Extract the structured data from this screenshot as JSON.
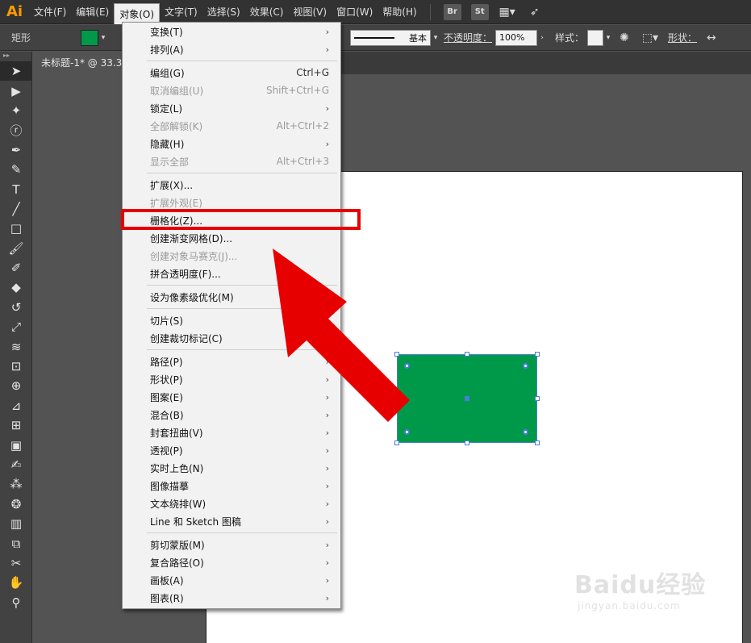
{
  "app": {
    "logo": "Ai"
  },
  "menubar": {
    "items": [
      "文件(F)",
      "编辑(E)",
      "对象(O)",
      "文字(T)",
      "选择(S)",
      "效果(C)",
      "视图(V)",
      "窗口(W)",
      "帮助(H)"
    ],
    "active_index": 2,
    "bridge_label": "Br",
    "stock_label": "St"
  },
  "controlbar": {
    "shape_label": "矩形",
    "fill_color": "#00994a",
    "stroke_label": "基本",
    "opacity_label": "不透明度：",
    "opacity_value": "100%",
    "style_label": "样式：",
    "shape_props_label": "形状："
  },
  "document": {
    "tab_title": "未标题-1* @ 33.3"
  },
  "object_menu": {
    "items": [
      {
        "label": "变换(T)",
        "shortcut": "",
        "submenu": true,
        "disabled": false
      },
      {
        "label": "排列(A)",
        "shortcut": "",
        "submenu": true,
        "disabled": false
      },
      {
        "label": "编组(G)",
        "shortcut": "Ctrl+G",
        "submenu": false,
        "disabled": false
      },
      {
        "label": "取消编组(U)",
        "shortcut": "Shift+Ctrl+G",
        "submenu": false,
        "disabled": true
      },
      {
        "label": "锁定(L)",
        "shortcut": "",
        "submenu": true,
        "disabled": false
      },
      {
        "label": "全部解锁(K)",
        "shortcut": "Alt+Ctrl+2",
        "submenu": false,
        "disabled": true
      },
      {
        "label": "隐藏(H)",
        "shortcut": "",
        "submenu": true,
        "disabled": false
      },
      {
        "label": "显示全部",
        "shortcut": "Alt+Ctrl+3",
        "submenu": false,
        "disabled": true
      },
      {
        "label": "扩展(X)...",
        "shortcut": "",
        "submenu": false,
        "disabled": false
      },
      {
        "label": "扩展外观(E)",
        "shortcut": "",
        "submenu": false,
        "disabled": true
      },
      {
        "label": "栅格化(Z)...",
        "shortcut": "",
        "submenu": false,
        "disabled": false
      },
      {
        "label": "创建渐变网格(D)...",
        "shortcut": "",
        "submenu": false,
        "disabled": false
      },
      {
        "label": "创建对象马赛克(J)...",
        "shortcut": "",
        "submenu": false,
        "disabled": true
      },
      {
        "label": "拼合透明度(F)...",
        "shortcut": "",
        "submenu": false,
        "disabled": false
      },
      {
        "label": "设为像素级优化(M)",
        "shortcut": "",
        "submenu": false,
        "disabled": false
      },
      {
        "label": "切片(S)",
        "shortcut": "",
        "submenu": true,
        "disabled": false
      },
      {
        "label": "创建裁切标记(C)",
        "shortcut": "",
        "submenu": false,
        "disabled": false
      },
      {
        "label": "路径(P)",
        "shortcut": "",
        "submenu": true,
        "disabled": false
      },
      {
        "label": "形状(P)",
        "shortcut": "",
        "submenu": true,
        "disabled": false
      },
      {
        "label": "图案(E)",
        "shortcut": "",
        "submenu": true,
        "disabled": false
      },
      {
        "label": "混合(B)",
        "shortcut": "",
        "submenu": true,
        "disabled": false
      },
      {
        "label": "封套扭曲(V)",
        "shortcut": "",
        "submenu": true,
        "disabled": false
      },
      {
        "label": "透视(P)",
        "shortcut": "",
        "submenu": true,
        "disabled": false
      },
      {
        "label": "实时上色(N)",
        "shortcut": "",
        "submenu": true,
        "disabled": false
      },
      {
        "label": "图像描摹",
        "shortcut": "",
        "submenu": true,
        "disabled": false
      },
      {
        "label": "文本绕排(W)",
        "shortcut": "",
        "submenu": true,
        "disabled": false
      },
      {
        "label": "Line 和 Sketch 图稿",
        "shortcut": "",
        "submenu": true,
        "disabled": false
      },
      {
        "label": "剪切蒙版(M)",
        "shortcut": "",
        "submenu": true,
        "disabled": false
      },
      {
        "label": "复合路径(O)",
        "shortcut": "",
        "submenu": true,
        "disabled": false
      },
      {
        "label": "画板(A)",
        "shortcut": "",
        "submenu": true,
        "disabled": false
      },
      {
        "label": "图表(R)",
        "shortcut": "",
        "submenu": true,
        "disabled": false
      }
    ],
    "highlighted_label": "栅格化(Z)..."
  },
  "colors": {
    "annotation_red": "#e60000",
    "selection_blue": "#4a7dd6",
    "shape_green": "#00994a"
  },
  "watermark": {
    "main": "Baidu经验",
    "sub": "jingyan.baidu.com"
  }
}
